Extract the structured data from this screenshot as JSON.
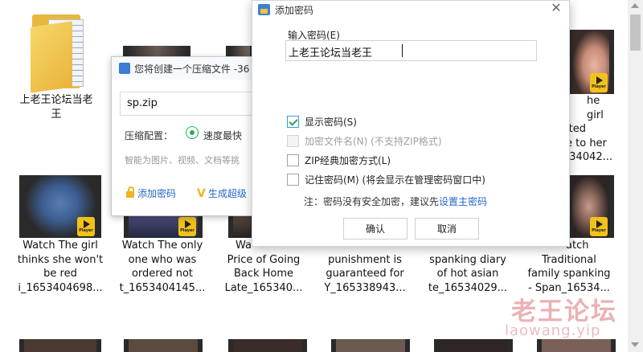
{
  "files": {
    "folder": {
      "name": "上老王论坛当老王",
      "icon": "folder-icon"
    },
    "row1_partial": [
      {
        "line1": "he girl",
        "line2": "ited",
        "line3": "e to her",
        "line4": "534042..."
      }
    ],
    "row2": [
      {
        "lines": [
          "Watch The girl",
          "thinks she won't",
          "be red",
          "i_1653404698..."
        ]
      },
      {
        "lines": [
          "Watch The only",
          "one who was",
          "ordered not",
          "t_1653404145..."
        ]
      },
      {
        "lines": [
          "Wa",
          "Price of Going",
          "Back Home",
          "Late_165340..."
        ]
      },
      {
        "lines": [
          "",
          "punishment is",
          "guaranteed for",
          "Y_165338943..."
        ]
      },
      {
        "lines": [
          "",
          "spanking diary",
          "of hot asian",
          "te_16534029..."
        ]
      },
      {
        "lines": [
          "atch",
          "Traditional",
          "family spanking",
          "- Span_16534..."
        ]
      }
    ],
    "player_badge": "Player"
  },
  "zip_dialog": {
    "title": "您将创建一个压缩文件 -36",
    "filename": "sp.zip",
    "config_label": "压缩配置：",
    "config_value": "速度最快",
    "hint": "智能为图片、视频、文档等挑",
    "add_password": "添加密码",
    "generate": "生成超级"
  },
  "password_dialog": {
    "title": "添加密码",
    "close": "✕",
    "input_label": "输入密码(E)",
    "input_value": "上老王论坛当老王",
    "options": [
      {
        "label": "显示密码(S)",
        "checked": true,
        "disabled": false
      },
      {
        "label": "加密文件名(N)  (不支持ZIP格式)",
        "checked": false,
        "disabled": true
      },
      {
        "label": "ZIP经典加密方式(L)",
        "checked": false,
        "disabled": false
      },
      {
        "label": "记住密码(M) (将会显示在管理密码窗口中)",
        "checked": false,
        "disabled": false
      }
    ],
    "note_prefix": "注：密码没有安全加密，建议先",
    "note_link": "设置主密码",
    "ok": "确认",
    "cancel": "取消"
  },
  "watermark": {
    "cn": "老王论坛",
    "url": "laowang.yip"
  }
}
